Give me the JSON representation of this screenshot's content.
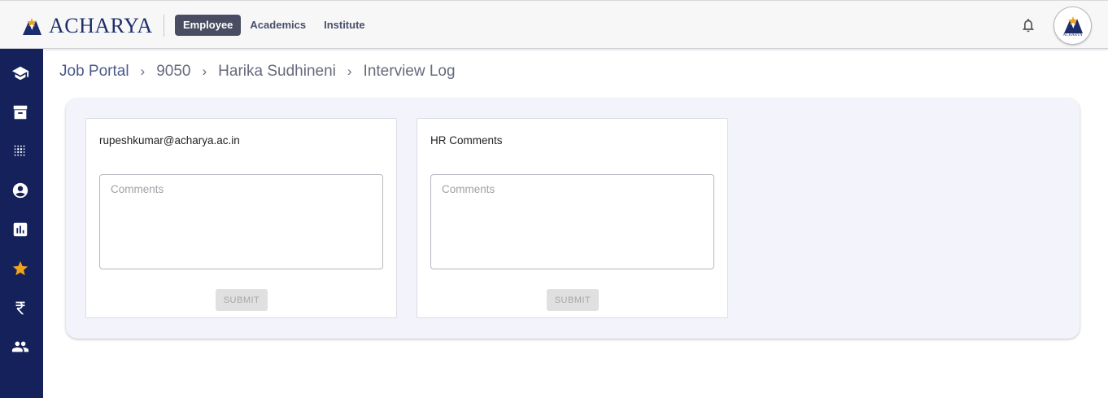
{
  "header": {
    "logo_text": "ACHARYA",
    "nav": [
      {
        "label": "Employee",
        "active": true
      },
      {
        "label": "Academics",
        "active": false
      },
      {
        "label": "Institute",
        "active": false
      }
    ],
    "avatar_text": "ACHARYA"
  },
  "sidebar": {
    "items": [
      {
        "icon": "graduation-cap-icon"
      },
      {
        "icon": "archive-icon"
      },
      {
        "icon": "dots-grid-icon"
      },
      {
        "icon": "account-circle-icon"
      },
      {
        "icon": "bar-chart-icon"
      },
      {
        "icon": "star-icon",
        "color": "#f0a21c"
      },
      {
        "icon": "rupee-icon"
      },
      {
        "icon": "people-icon"
      }
    ]
  },
  "breadcrumb": [
    "Job Portal",
    "9050",
    "Harika Sudhineni",
    "Interview Log"
  ],
  "cards": [
    {
      "title": "rupeshkumar@acharya.ac.in",
      "placeholder": "Comments",
      "submit_label": "SUBMIT"
    },
    {
      "title": "HR Comments",
      "placeholder": "Comments",
      "submit_label": "SUBMIT"
    }
  ],
  "colors": {
    "sidebar": "#14215a",
    "brand": "#1c2d6b",
    "accent_star": "#f0a21c"
  }
}
